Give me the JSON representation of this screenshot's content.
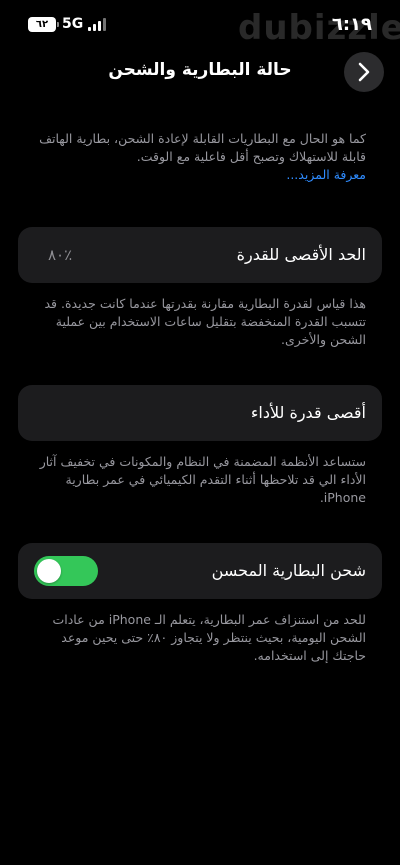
{
  "status_bar": {
    "time": "٦:١٩",
    "network": "5G",
    "battery_level": "٦٢",
    "watermark": "dubizzle"
  },
  "nav": {
    "title": "حالة البطارية والشحن",
    "back_icon": "chevron-right-icon"
  },
  "intro": {
    "text": "كما هو الحال مع البطاريات القابلة لإعادة الشحن، بطارية الهاتف قابلة للاستهلاك وتصبح أقل فاعلية مع الوقت.",
    "learn_more": "معرفة المزيد..."
  },
  "maximum_capacity": {
    "label": "الحد الأقصى للقدرة",
    "value": "٨٠٪",
    "description": "هذا قياس لقدرة البطارية مقارنة بقدرتها عندما كانت جديدة. قد تتسبب القدرة المنخفضة بتقليل ساعات الاستخدام بين عملية الشحن والأخرى."
  },
  "peak_performance": {
    "label": "أقصى قدرة للأداء",
    "description": "ستساعد الأنظمة المضمنة في النظام والمكونات في تخفيف آثار الأداء الي قد تلاحظها أثناء التقدم الكيميائي في عمر بطارية iPhone."
  },
  "optimized_charging": {
    "label": "شحن البطارية المحسن",
    "enabled": true,
    "description": "للحد من استنزاف عمر البطارية، يتعلم الـ iPhone من عادات الشحن اليومية، بحيث ينتظر ولا يتجاوز ٨٠٪ حتى يحين موعد حاجتك إلى استخدامه."
  },
  "colors": {
    "background": "#000000",
    "card": "#1c1c1e",
    "link": "#2f8cff",
    "toggle_on": "#34c759",
    "secondary_text": "#98989f"
  }
}
